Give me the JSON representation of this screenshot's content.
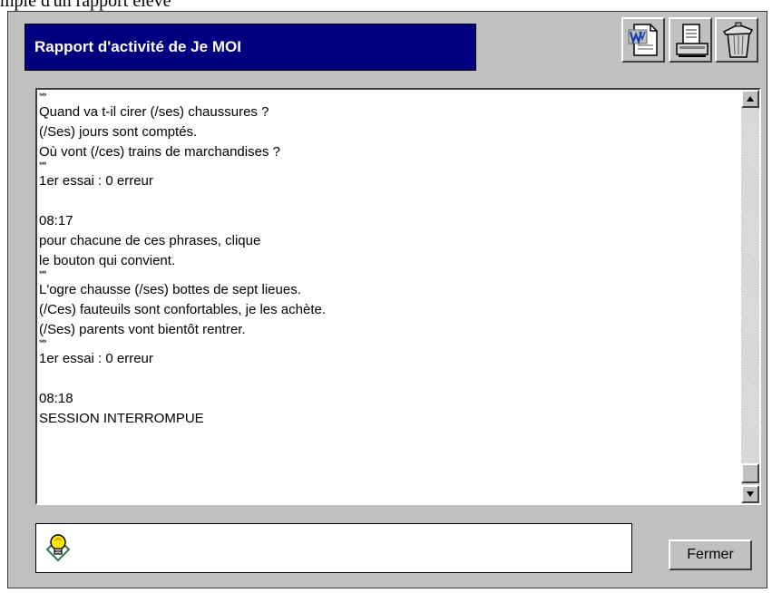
{
  "page_caption": "mple d'un rapport élève",
  "window": {
    "title": "Rapport d'activité de Je MOI"
  },
  "toolbar": {
    "word_icon": "word-document-icon",
    "print_icon": "printer-icon",
    "trash_icon": "trash-can-icon"
  },
  "report": {
    "lines": [
      {
        "kind": "sep",
        "text": "***"
      },
      {
        "kind": "text",
        "text": "Quand va t-il cirer (/ses) chaussures ?"
      },
      {
        "kind": "text",
        "text": "(/Ses) jours sont comptés."
      },
      {
        "kind": "text",
        "text": "Où vont (/ces) trains de marchandises ?"
      },
      {
        "kind": "sep",
        "text": "***"
      },
      {
        "kind": "text",
        "text": "1er essai : 0 erreur"
      },
      {
        "kind": "blank",
        "text": ""
      },
      {
        "kind": "text",
        "text": "08:17"
      },
      {
        "kind": "text",
        "text": "pour chacune de ces phrases, clique"
      },
      {
        "kind": "text",
        "text": "le bouton qui convient."
      },
      {
        "kind": "sep",
        "text": "***"
      },
      {
        "kind": "text",
        "text": "L'ogre chausse (/ses) bottes de sept lieues."
      },
      {
        "kind": "text",
        "text": "(/Ces) fauteuils sont confortables, je les achète."
      },
      {
        "kind": "text",
        "text": "(/Ses) parents vont bientôt rentrer."
      },
      {
        "kind": "sep",
        "text": "***"
      },
      {
        "kind": "text",
        "text": "1er essai : 0 erreur"
      },
      {
        "kind": "blank",
        "text": ""
      },
      {
        "kind": "text",
        "text": "08:18"
      },
      {
        "kind": "text",
        "text": "SESSION INTERROMPUE"
      }
    ]
  },
  "hint": {
    "icon": "lightbulb-icon",
    "text": ""
  },
  "buttons": {
    "close_label": "Fermer"
  }
}
